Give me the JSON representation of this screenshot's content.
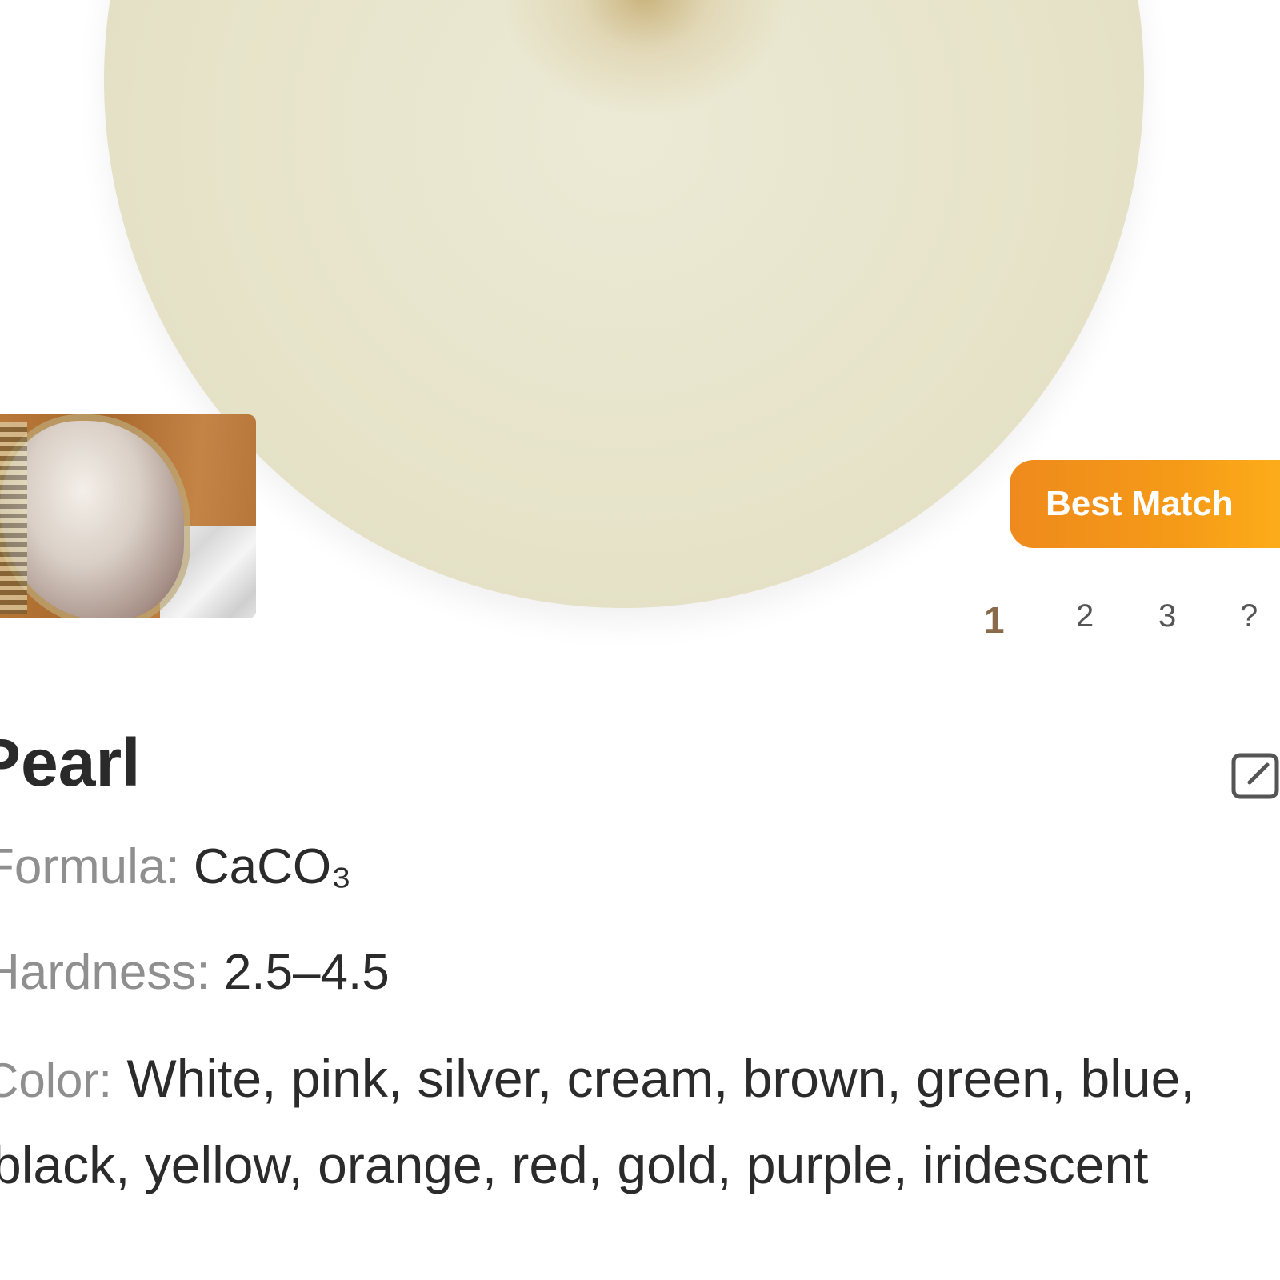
{
  "hero": {
    "image": "pearl-main-photo"
  },
  "thumbnail": {
    "image": "pearl-jewelry-photo"
  },
  "badge": {
    "label": "Best Match"
  },
  "pagination": {
    "pages": [
      "1",
      "2",
      "3",
      "?"
    ],
    "active": "1"
  },
  "mineral": {
    "name": "Pearl",
    "formula_label": "Formula:",
    "formula_value": "CaCO₃",
    "hardness_label": "Hardness:",
    "hardness_value": "2.5–4.5",
    "color_label": "Color:",
    "color_value_line1": "White, pink, silver, cream, brown, green, blue,",
    "color_value_line2": "black, yellow, orange, red, gold, purple, iridescent"
  },
  "icons": {
    "edit": "edit-icon"
  },
  "colors": {
    "accent": "#f59a18",
    "active_page": "#8a6a4a",
    "label_gray": "#8f8f8f"
  }
}
